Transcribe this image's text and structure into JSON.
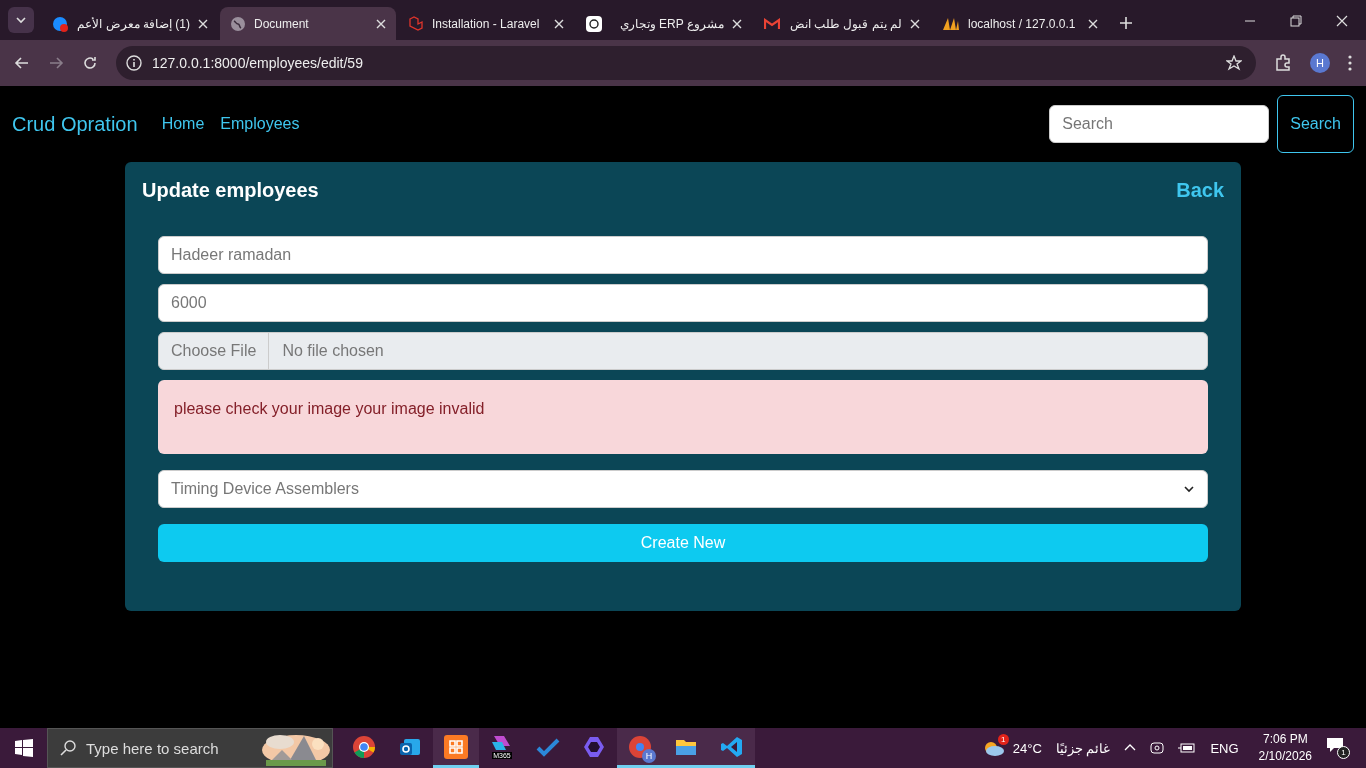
{
  "browser": {
    "tabs": [
      {
        "kind": "globe-badge",
        "title": "(1) إضافة معرض الأعم",
        "selected": false
      },
      {
        "kind": "globe",
        "title": "Document",
        "selected": true
      },
      {
        "kind": "laravel",
        "title": "Installation - Laravel",
        "selected": false
      },
      {
        "kind": "ai",
        "title": "مشروع ERP وتجاري",
        "selected": false
      },
      {
        "kind": "mail",
        "title": "لم يتم قبول طلب انض",
        "selected": false
      },
      {
        "kind": "pma",
        "title": "localhost / 127.0.0.1",
        "selected": false
      }
    ],
    "url": "127.0.0.1:8000/employees/edit/59",
    "profile": "H"
  },
  "navbar": {
    "brand": "Crud Opration",
    "links": [
      "Home",
      "Employees"
    ],
    "search": {
      "placeholder": "Search"
    },
    "search_button": "Search"
  },
  "card": {
    "title": "Update employees",
    "back": "Back",
    "fields": [
      {
        "kind": "text",
        "value": "Hadeer ramadan"
      },
      {
        "kind": "text",
        "value": "6000"
      },
      {
        "kind": "file",
        "button": "Choose File",
        "value": "No file chosen"
      },
      {
        "kind": "alert",
        "value": "please check your image your image invalid"
      },
      {
        "kind": "select",
        "value": "Timing Device Assemblers"
      }
    ],
    "submit": "Create New"
  },
  "taskbar": {
    "search": {
      "placeholder": "Type here to search"
    },
    "apps": [
      {
        "kind": "chrome",
        "running": false
      },
      {
        "kind": "outlook",
        "running": false
      },
      {
        "kind": "xampp",
        "running": true
      },
      {
        "kind": "m365",
        "running": false
      },
      {
        "kind": "todo",
        "running": false
      },
      {
        "kind": "copilot",
        "running": false
      },
      {
        "kind": "chrome-profile",
        "running": true
      },
      {
        "kind": "files",
        "running": true
      },
      {
        "kind": "vscode",
        "running": true
      }
    ],
    "m365_label": "M365",
    "profile_letter": "H",
    "weather_badge": "1",
    "temperature": "24°C",
    "weather": "غائم جزئيًا",
    "language": "ENG",
    "time": "7:06 PM",
    "date": "2/10/2026",
    "notification_count": "1"
  }
}
